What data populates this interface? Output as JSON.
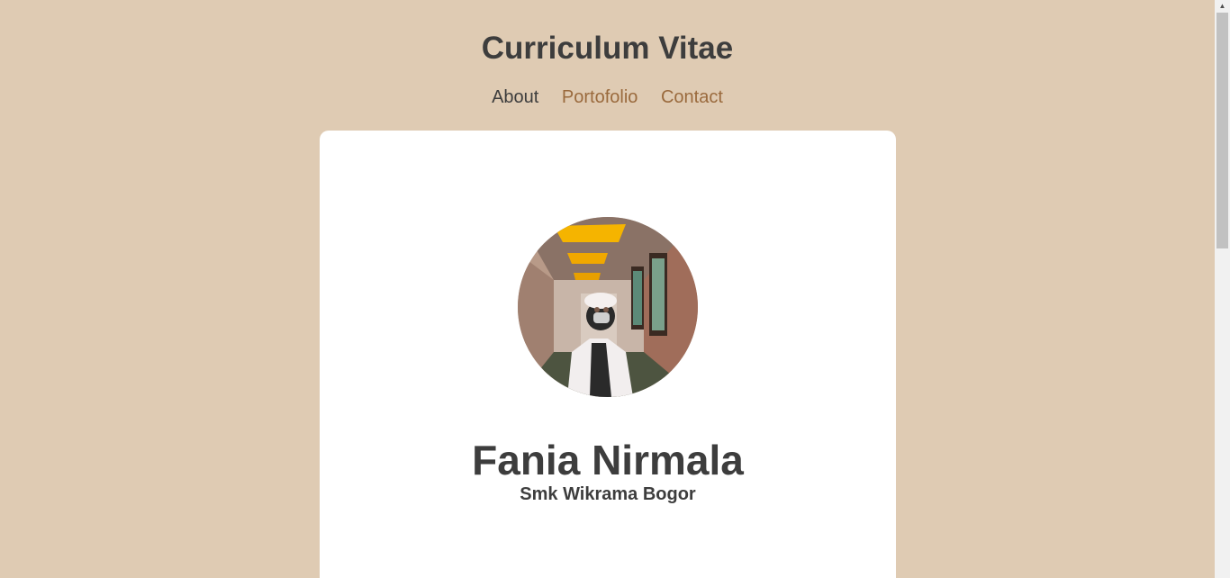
{
  "header": {
    "title": "Curriculum Vitae"
  },
  "nav": {
    "items": [
      {
        "label": "About"
      },
      {
        "label": "Portofolio"
      },
      {
        "label": "Contact"
      }
    ]
  },
  "profile": {
    "name": "Fania Nirmala",
    "school": "Smk Wikrama Bogor"
  },
  "colors": {
    "background": "#dfcbb3",
    "card": "#ffffff",
    "text": "#3d3d3d",
    "link": "#9a6a3d"
  },
  "scrollbar": {
    "up_arrow": "▲"
  }
}
